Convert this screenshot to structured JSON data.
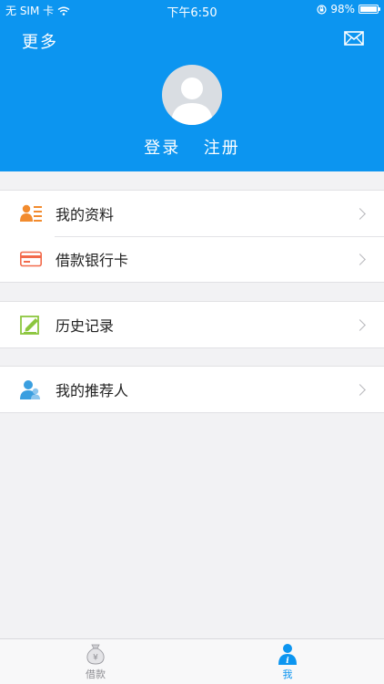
{
  "status": {
    "carrier": "无 SIM 卡",
    "time": "下午6:50",
    "battery": "98%",
    "battery_level": 0.98
  },
  "header": {
    "title": "更多",
    "login": "登录",
    "register": "注册"
  },
  "menu": [
    {
      "label": "我的资料",
      "icon": "profile-card-icon"
    },
    {
      "label": "借款银行卡",
      "icon": "bank-card-icon"
    },
    {
      "label": "历史记录",
      "icon": "history-edit-icon"
    },
    {
      "label": "我的推荐人",
      "icon": "referrer-icon"
    }
  ],
  "tabbar": {
    "tabs": [
      {
        "label": "借款",
        "icon": "money-bag-icon",
        "active": false
      },
      {
        "label": "我",
        "icon": "user-info-icon",
        "active": true
      }
    ]
  },
  "colors": {
    "brand": "#0c95f0",
    "orange": "#f28b2e",
    "green": "#8cc63f",
    "inactive": "#8e8e93"
  }
}
